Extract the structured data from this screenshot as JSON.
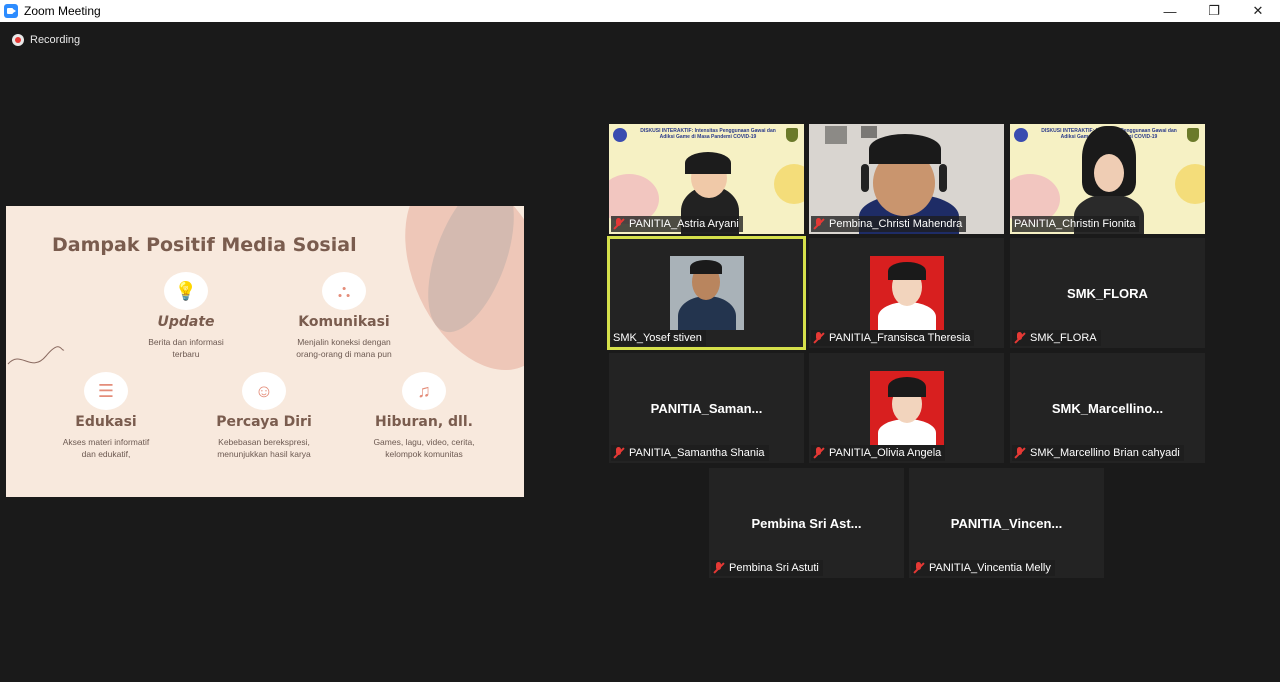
{
  "window": {
    "title": "Zoom Meeting",
    "controls": {
      "minimize": "—",
      "restore": "❐",
      "close": "✕"
    }
  },
  "recording": {
    "label": "Recording",
    "icon": "recording-icon"
  },
  "slide": {
    "title": "Dampak Positif Media Sosial",
    "features": [
      {
        "title": "Update",
        "desc1": "Berita dan informasi",
        "desc2": "terbaru",
        "icon": "lightbulb-icon"
      },
      {
        "title": "Komunikasi",
        "desc1": "Menjalin koneksi dengan",
        "desc2": "orang-orang di mana pun",
        "icon": "network-icon"
      },
      {
        "title": "Edukasi",
        "desc1": "Akses materi informatif",
        "desc2": "dan edukatif,",
        "icon": "books-icon"
      },
      {
        "title": "Percaya Diri",
        "desc1": "Kebebasan berekspresi,",
        "desc2": "menunjukkan hasil karya",
        "icon": "person-icon"
      },
      {
        "title": "Hiburan, dll.",
        "desc1": "Games, lagu, video, cerita,",
        "desc2": "kelompok komunitas",
        "icon": "music-icon"
      }
    ],
    "colors": {
      "background": "#f8e9dd",
      "heading": "#7a5c4e",
      "accent": "#e48d7a"
    }
  },
  "participants": [
    {
      "label": "PANITIA_Astria Aryani",
      "center": "",
      "muted": true,
      "video": "poster",
      "banner": "DISKUSI INTERAKTIF: Intensitas Penggunaan Gawai dan Adiksi Game di Masa Pandemi COVID-19"
    },
    {
      "label": "Pembina_Christi Mahendra",
      "center": "",
      "muted": true,
      "video": "room"
    },
    {
      "label": "PANITIA_Christin Fionita",
      "center": "",
      "muted": false,
      "video": "poster",
      "banner": "DISKUSI INTERAKTIF: Intensitas Penggunaan Gawai dan Adiksi Game di Masa Pandemi COVID-19"
    },
    {
      "label": "SMK_Yosef stiven",
      "center": "",
      "muted": false,
      "video": "photo-cam",
      "active": true
    },
    {
      "label": "PANITIA_Fransisca Theresia",
      "center": "",
      "muted": true,
      "video": "photo-red"
    },
    {
      "label": "SMK_FLORA",
      "center": "SMK_FLORA",
      "muted": true,
      "video": "none"
    },
    {
      "label": "PANITIA_Samantha Shania",
      "center": "PANITIA_Saman...",
      "muted": true,
      "video": "none"
    },
    {
      "label": "PANITIA_Olivia Angela",
      "center": "",
      "muted": true,
      "video": "photo-red"
    },
    {
      "label": "SMK_Marcellino Brian cahyadi",
      "center": "SMK_Marcellino...",
      "muted": true,
      "video": "none"
    },
    {
      "label": "Pembina Sri Astuti",
      "center": "Pembina Sri Ast...",
      "muted": true,
      "video": "none"
    },
    {
      "label": "PANITIA_Vincentia Melly",
      "center": "PANITIA_Vincen...",
      "muted": true,
      "video": "none"
    }
  ],
  "colors": {
    "app_background": "#1a1a1a",
    "tile_background": "#232323",
    "active_speaker": "#d5e04b",
    "muted": "#e53935",
    "zoom_blue": "#2d8cff"
  }
}
